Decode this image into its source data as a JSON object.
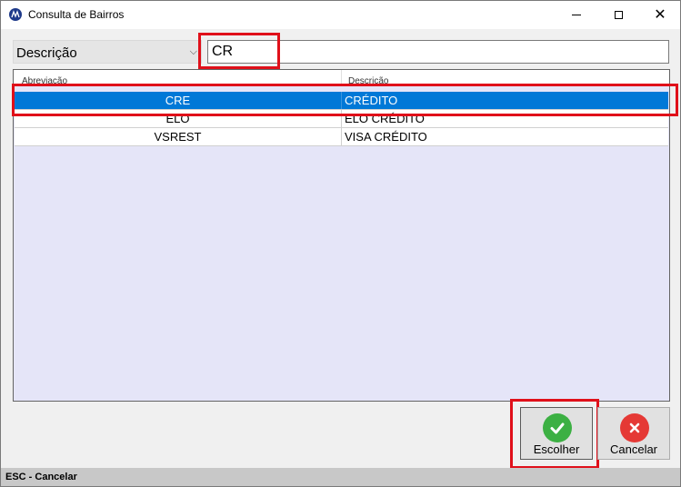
{
  "window": {
    "title": "Consulta de Bairros",
    "minimize": "minimize",
    "maximize": "maximize",
    "close": "✕"
  },
  "filter": {
    "field_selected": "Descrição",
    "search_value": "CR"
  },
  "grid": {
    "columns": [
      "Abreviação",
      "Descrição"
    ],
    "rows": [
      {
        "abreviacao": "CRE",
        "descricao": "CRÉDITO",
        "selected": true
      },
      {
        "abreviacao": "ELO",
        "descricao": "ELO CRÉDITO",
        "selected": false
      },
      {
        "abreviacao": "VSREST",
        "descricao": "VISA CRÉDITO",
        "selected": false
      }
    ]
  },
  "buttons": {
    "choose_label": "Escolher",
    "cancel_label": "Cancelar"
  },
  "status_bar": {
    "text": "ESC - Cancelar"
  },
  "colors": {
    "highlight": "#e0101a",
    "selection": "#0078d7",
    "grid_bg": "#e5e5f8",
    "ok_icon": "#3cb043",
    "cancel_icon": "#e53935"
  }
}
